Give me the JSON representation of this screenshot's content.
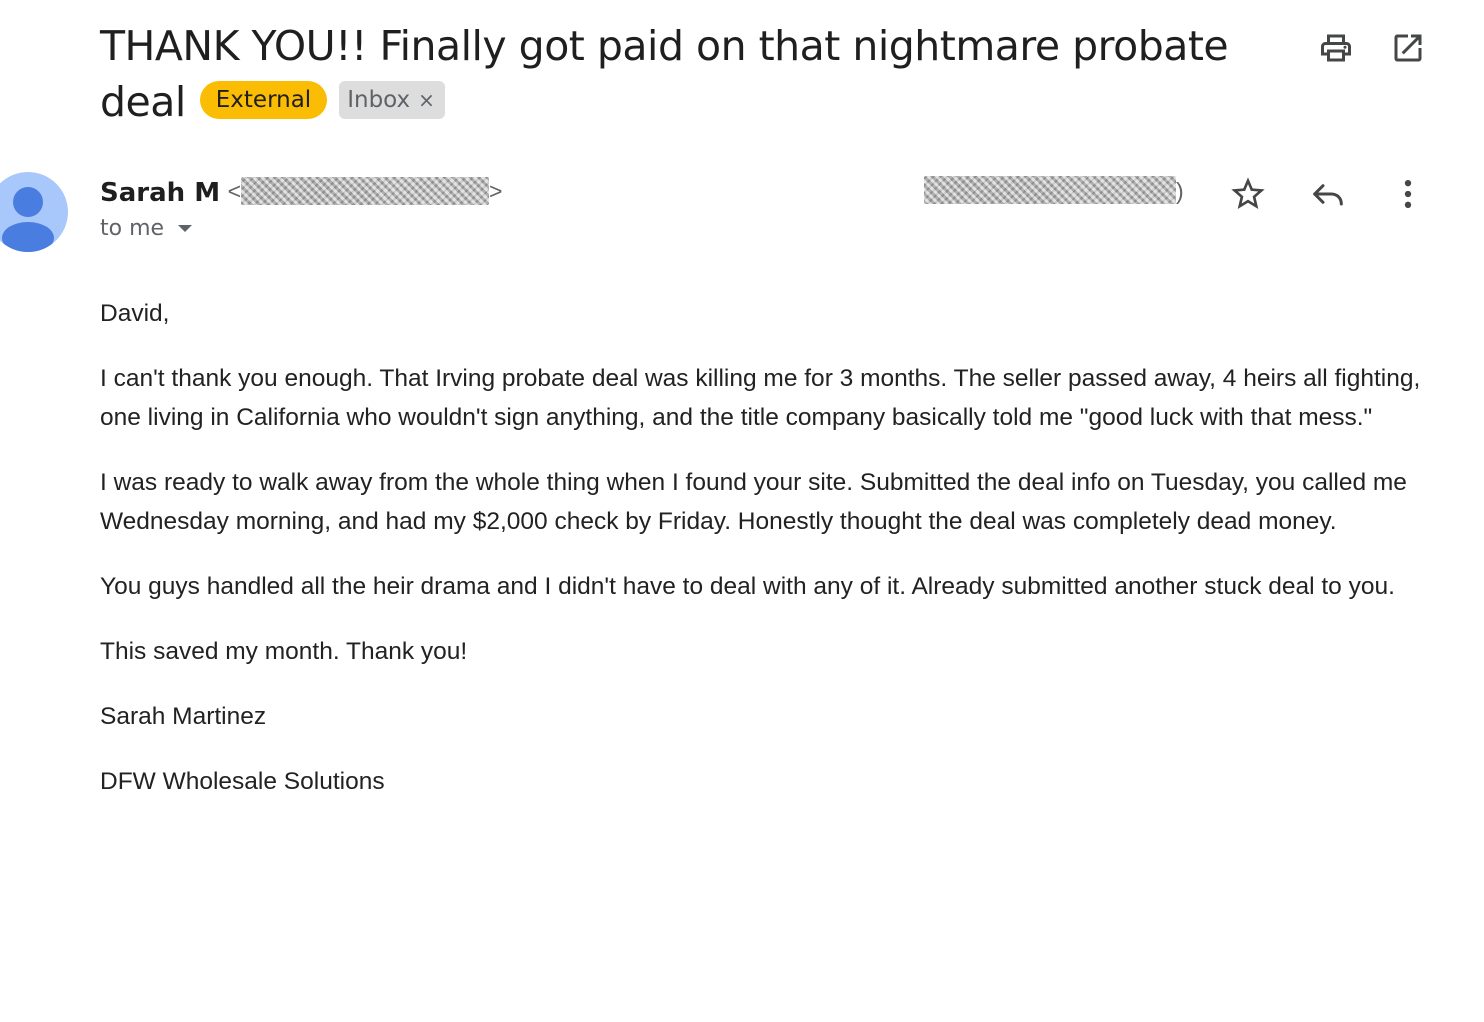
{
  "email": {
    "subject": "THANK YOU!! Finally got paid on that nightmare probate deal",
    "labels": {
      "external": "External",
      "inbox": "Inbox",
      "inbox_remove": "×"
    },
    "sender": {
      "name": "Sarah M",
      "open_angle": "<",
      "close_angle": ">",
      "date_close_paren": ")"
    },
    "recipient": "to me",
    "body": {
      "greeting": "David,",
      "paragraphs": [
        "I can't thank you enough. That Irving probate deal was killing me for 3 months. The seller passed away, 4 heirs all fighting, one living in California who wouldn't sign anything, and the title company basically told me \"good luck with that mess.\"",
        "I was ready to walk away from the whole thing when I found your site. Submitted the deal info on Tuesday, you called me Wednesday morning, and had my $2,000 check by Friday. Honestly thought the deal was completely dead money.",
        "You guys handled all the heir drama and I didn't have to deal with any of it. Already submitted another stuck deal to you.",
        "This saved my month. Thank you!"
      ],
      "signature_name": "Sarah Martinez",
      "signature_company": "DFW Wholesale Solutions"
    }
  },
  "icons": {
    "print": "print-icon",
    "open_new_window": "open-in-new-icon",
    "star": "star-icon",
    "reply": "reply-icon",
    "more": "more-vert-icon",
    "avatar": "person-avatar-icon"
  },
  "colors": {
    "external_chip": "#fbbc04",
    "inbox_chip": "#dddddd",
    "avatar_bg": "#a8c7fa",
    "avatar_fg": "#4a7de0",
    "icon": "#444746"
  }
}
